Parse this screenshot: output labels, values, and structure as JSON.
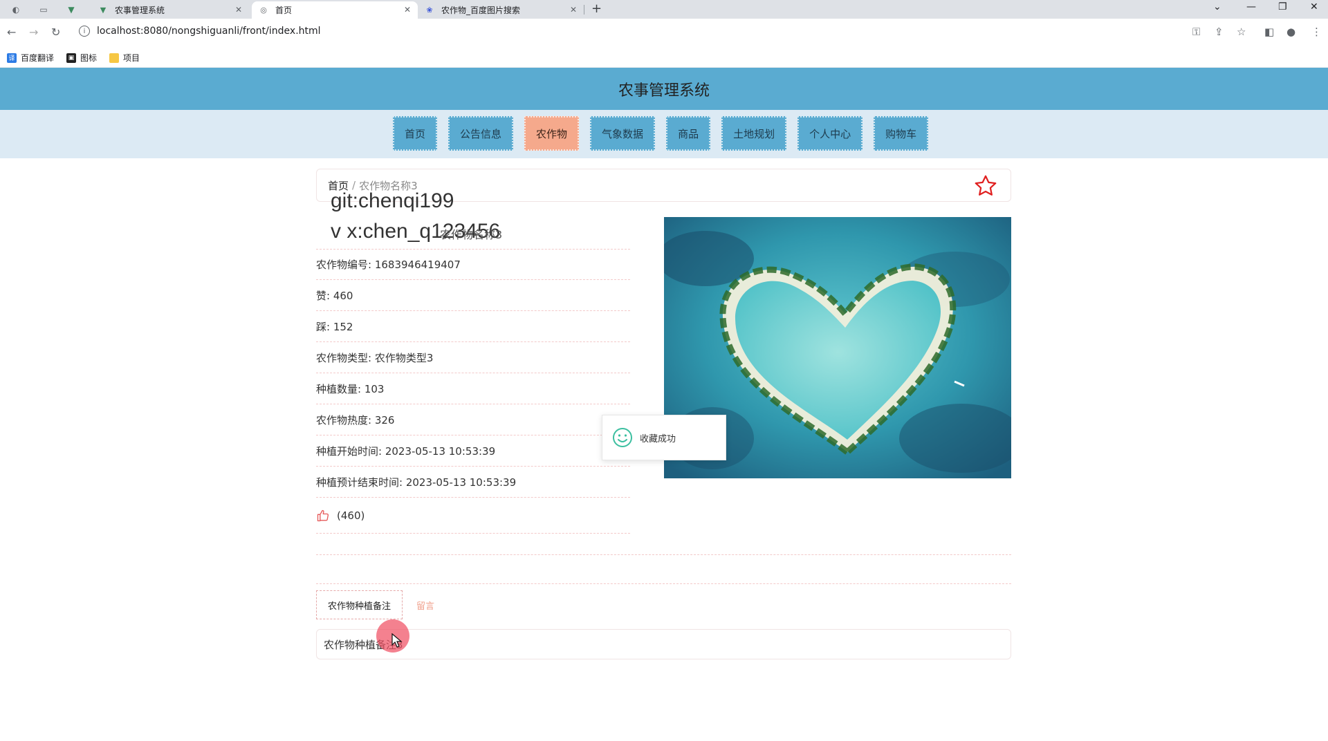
{
  "browser": {
    "tabs": [
      {
        "title": "农事管理系统",
        "icon": "vue-icon"
      },
      {
        "title": "首页",
        "icon": "globe-icon",
        "active": true
      },
      {
        "title": "农作物_百度图片搜索",
        "icon": "baidu-paw-icon"
      }
    ],
    "url": "localhost:8080/nongshiguanli/front/index.html",
    "bookmarks": [
      {
        "label": "百度翻译",
        "icon": "translate-icon",
        "color": "#2c7be5"
      },
      {
        "label": "图标",
        "icon": "bookmark-dark-icon",
        "color": "#222222"
      },
      {
        "label": "项目",
        "icon": "folder-icon",
        "color": "#f6c744"
      }
    ]
  },
  "site": {
    "title": "农事管理系统",
    "header_color": "#5aabd1",
    "nav": [
      {
        "label": "首页"
      },
      {
        "label": "公告信息"
      },
      {
        "label": "农作物",
        "active": true
      },
      {
        "label": "气象数据"
      },
      {
        "label": "商品"
      },
      {
        "label": "土地规划"
      },
      {
        "label": "个人中心"
      },
      {
        "label": "购物车"
      }
    ]
  },
  "breadcrumb": {
    "home": "首页",
    "separator": "/",
    "current": "农作物名称3"
  },
  "watermark": {
    "line1": "git:chenqi199",
    "line2": "v x:chen_q123456"
  },
  "detail": {
    "title": "农作物名称3",
    "fields": [
      {
        "text": "农作物编号: 1683946419407"
      },
      {
        "text": "赞: 460"
      },
      {
        "text": "踩: 152"
      },
      {
        "text": "农作物类型: 农作物类型3"
      },
      {
        "text": "种植数量: 103"
      },
      {
        "text": "农作物热度: 326"
      },
      {
        "text": "种植开始时间: 2023-05-13 10:53:39"
      },
      {
        "text": "种植预计结束时间: 2023-05-13 10:53:39"
      }
    ],
    "like_count": "(460)"
  },
  "toast": {
    "message": "收藏成功"
  },
  "tabs": [
    {
      "label": "农作物种植备注",
      "active": true
    },
    {
      "label": "留言"
    }
  ],
  "note": "农作物种植备注3"
}
